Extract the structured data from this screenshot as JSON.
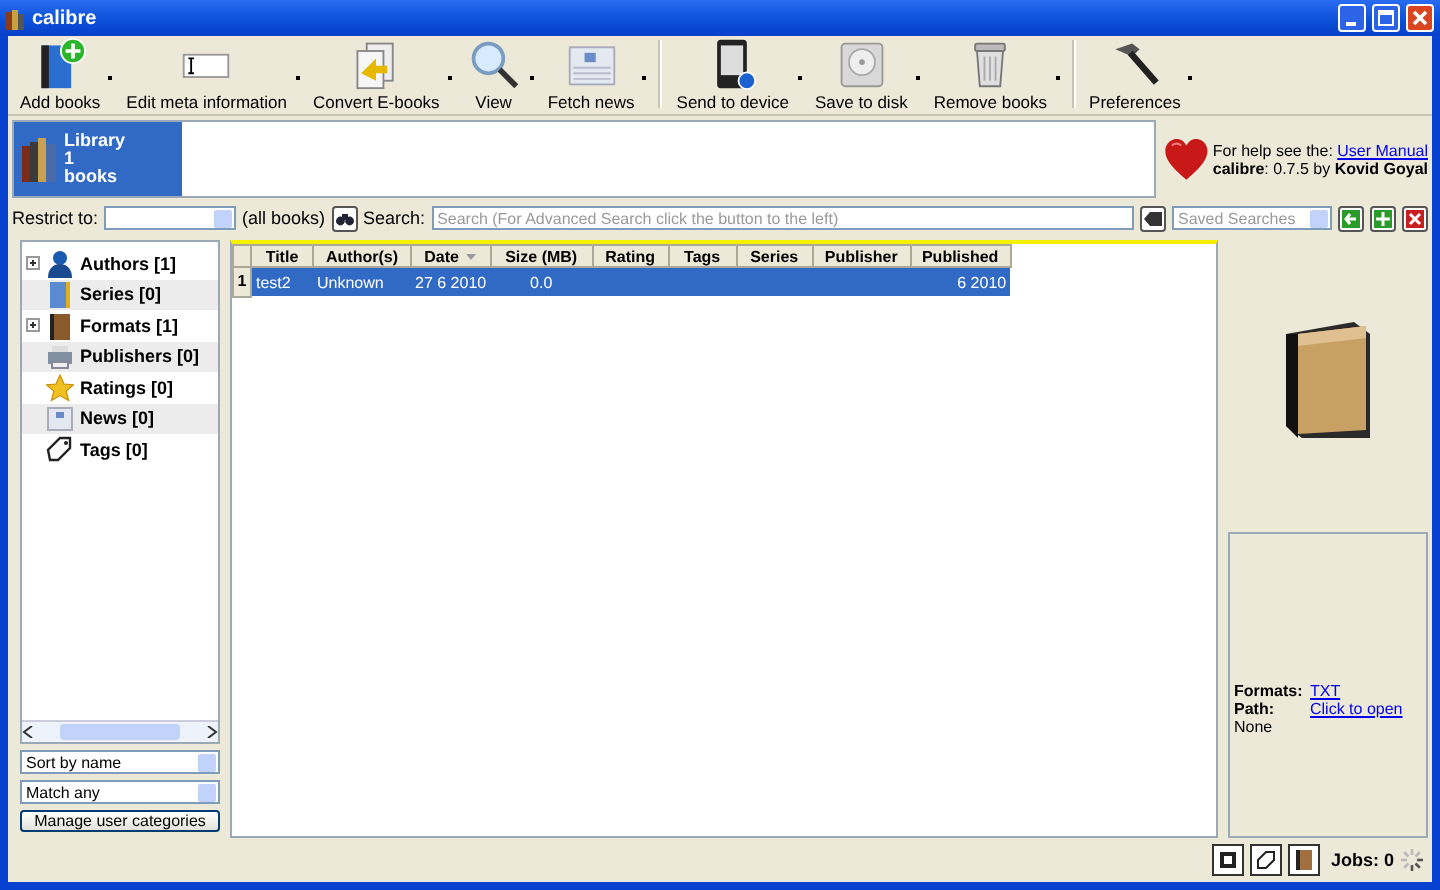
{
  "window": {
    "title": "calibre"
  },
  "toolbar": [
    {
      "label": "Add books"
    },
    {
      "label": "Edit meta information"
    },
    {
      "label": "Convert E-books"
    },
    {
      "label": "View"
    },
    {
      "label": "Fetch news",
      "group_end": true
    },
    {
      "label": "Send to device"
    },
    {
      "label": "Save to disk"
    },
    {
      "label": "Remove books",
      "group_end": true
    },
    {
      "label": "Preferences"
    }
  ],
  "library": {
    "name": "Library",
    "count": "1",
    "unit": "books",
    "selected": true
  },
  "help": {
    "text": "For help see the: ",
    "link": "User Manual",
    "version": "**calibre**: 0.7.5 by **Kovid Goyal**"
  },
  "search_bar": {
    "restrict_label": "Restrict to:",
    "restrict_note": "(all books)",
    "search_label": "Search:",
    "search_placeholder": "Search (For Advanced Search click the button to the left)",
    "saved_placeholder": "Saved Searches"
  },
  "tag_browser": {
    "items": [
      {
        "label": "Authors [1]",
        "kind": "branch",
        "expanded": false
      },
      {
        "label": "Series [0]",
        "kind": "leaf"
      },
      {
        "label": "Formats [1]",
        "kind": "branch",
        "expanded": false
      },
      {
        "label": "Publishers [0]",
        "kind": "leaf"
      },
      {
        "label": "Ratings [0]",
        "kind": "leaf"
      },
      {
        "label": "News [0]",
        "kind": "leaf"
      },
      {
        "label": "Tags [0]",
        "kind": "leaf"
      }
    ],
    "sort": "Sort by name",
    "match": "Match any",
    "manage_button": "Manage user categories"
  },
  "table": {
    "columns": [
      {
        "label": "Title",
        "sorted": false
      },
      {
        "label": "Author(s)",
        "sorted": false
      },
      {
        "label": "Date",
        "sorted": true
      },
      {
        "label": "Size (MB)",
        "sorted": false
      },
      {
        "label": "Rating",
        "sorted": false
      },
      {
        "label": "Tags",
        "sorted": false
      },
      {
        "label": "Series",
        "sorted": false
      },
      {
        "label": "Publisher",
        "sorted": false
      },
      {
        "label": "Published",
        "sorted": false
      }
    ],
    "rows": [
      {
        "number": "1",
        "selected": true,
        "cells": [
          "test2",
          "Unknown",
          "27 6 2010",
          "0.0",
          "",
          "",
          "",
          "",
          "6 2010"
        ]
      }
    ]
  },
  "details": {
    "formats_label": "Formats:",
    "formats_value": "TXT",
    "path_label": "Path:",
    "path_value": "Click to open",
    "comments": "None"
  },
  "status_bar": {
    "jobs": "Jobs: 0"
  }
}
